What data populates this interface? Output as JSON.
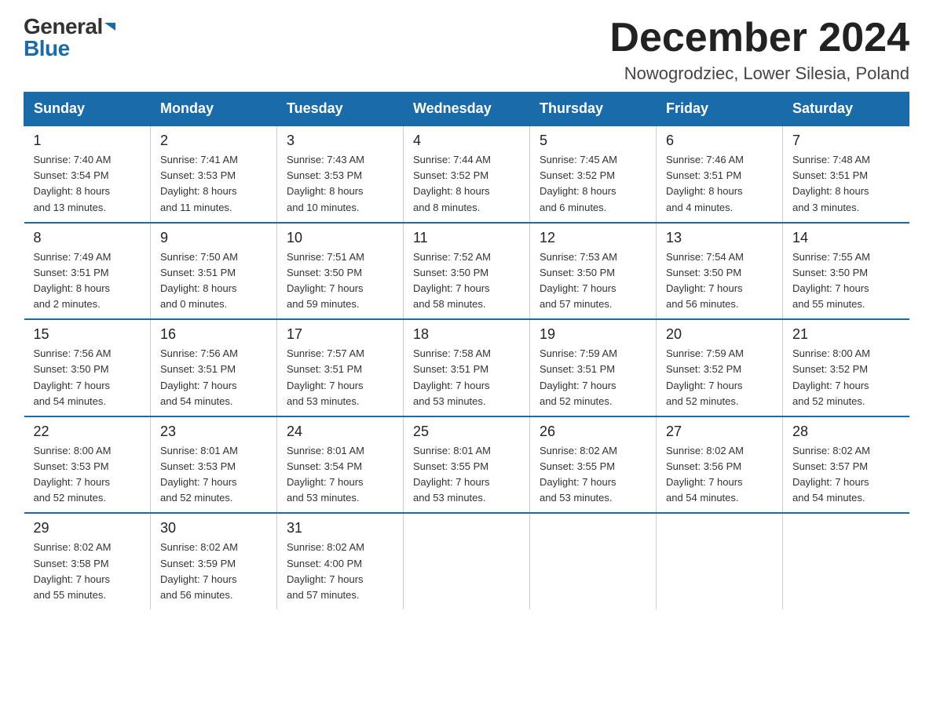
{
  "logo": {
    "general": "General",
    "blue": "Blue"
  },
  "title": "December 2024",
  "subtitle": "Nowogrodziec, Lower Silesia, Poland",
  "headers": [
    "Sunday",
    "Monday",
    "Tuesday",
    "Wednesday",
    "Thursday",
    "Friday",
    "Saturday"
  ],
  "weeks": [
    [
      {
        "day": "1",
        "info": "Sunrise: 7:40 AM\nSunset: 3:54 PM\nDaylight: 8 hours\nand 13 minutes."
      },
      {
        "day": "2",
        "info": "Sunrise: 7:41 AM\nSunset: 3:53 PM\nDaylight: 8 hours\nand 11 minutes."
      },
      {
        "day": "3",
        "info": "Sunrise: 7:43 AM\nSunset: 3:53 PM\nDaylight: 8 hours\nand 10 minutes."
      },
      {
        "day": "4",
        "info": "Sunrise: 7:44 AM\nSunset: 3:52 PM\nDaylight: 8 hours\nand 8 minutes."
      },
      {
        "day": "5",
        "info": "Sunrise: 7:45 AM\nSunset: 3:52 PM\nDaylight: 8 hours\nand 6 minutes."
      },
      {
        "day": "6",
        "info": "Sunrise: 7:46 AM\nSunset: 3:51 PM\nDaylight: 8 hours\nand 4 minutes."
      },
      {
        "day": "7",
        "info": "Sunrise: 7:48 AM\nSunset: 3:51 PM\nDaylight: 8 hours\nand 3 minutes."
      }
    ],
    [
      {
        "day": "8",
        "info": "Sunrise: 7:49 AM\nSunset: 3:51 PM\nDaylight: 8 hours\nand 2 minutes."
      },
      {
        "day": "9",
        "info": "Sunrise: 7:50 AM\nSunset: 3:51 PM\nDaylight: 8 hours\nand 0 minutes."
      },
      {
        "day": "10",
        "info": "Sunrise: 7:51 AM\nSunset: 3:50 PM\nDaylight: 7 hours\nand 59 minutes."
      },
      {
        "day": "11",
        "info": "Sunrise: 7:52 AM\nSunset: 3:50 PM\nDaylight: 7 hours\nand 58 minutes."
      },
      {
        "day": "12",
        "info": "Sunrise: 7:53 AM\nSunset: 3:50 PM\nDaylight: 7 hours\nand 57 minutes."
      },
      {
        "day": "13",
        "info": "Sunrise: 7:54 AM\nSunset: 3:50 PM\nDaylight: 7 hours\nand 56 minutes."
      },
      {
        "day": "14",
        "info": "Sunrise: 7:55 AM\nSunset: 3:50 PM\nDaylight: 7 hours\nand 55 minutes."
      }
    ],
    [
      {
        "day": "15",
        "info": "Sunrise: 7:56 AM\nSunset: 3:50 PM\nDaylight: 7 hours\nand 54 minutes."
      },
      {
        "day": "16",
        "info": "Sunrise: 7:56 AM\nSunset: 3:51 PM\nDaylight: 7 hours\nand 54 minutes."
      },
      {
        "day": "17",
        "info": "Sunrise: 7:57 AM\nSunset: 3:51 PM\nDaylight: 7 hours\nand 53 minutes."
      },
      {
        "day": "18",
        "info": "Sunrise: 7:58 AM\nSunset: 3:51 PM\nDaylight: 7 hours\nand 53 minutes."
      },
      {
        "day": "19",
        "info": "Sunrise: 7:59 AM\nSunset: 3:51 PM\nDaylight: 7 hours\nand 52 minutes."
      },
      {
        "day": "20",
        "info": "Sunrise: 7:59 AM\nSunset: 3:52 PM\nDaylight: 7 hours\nand 52 minutes."
      },
      {
        "day": "21",
        "info": "Sunrise: 8:00 AM\nSunset: 3:52 PM\nDaylight: 7 hours\nand 52 minutes."
      }
    ],
    [
      {
        "day": "22",
        "info": "Sunrise: 8:00 AM\nSunset: 3:53 PM\nDaylight: 7 hours\nand 52 minutes."
      },
      {
        "day": "23",
        "info": "Sunrise: 8:01 AM\nSunset: 3:53 PM\nDaylight: 7 hours\nand 52 minutes."
      },
      {
        "day": "24",
        "info": "Sunrise: 8:01 AM\nSunset: 3:54 PM\nDaylight: 7 hours\nand 53 minutes."
      },
      {
        "day": "25",
        "info": "Sunrise: 8:01 AM\nSunset: 3:55 PM\nDaylight: 7 hours\nand 53 minutes."
      },
      {
        "day": "26",
        "info": "Sunrise: 8:02 AM\nSunset: 3:55 PM\nDaylight: 7 hours\nand 53 minutes."
      },
      {
        "day": "27",
        "info": "Sunrise: 8:02 AM\nSunset: 3:56 PM\nDaylight: 7 hours\nand 54 minutes."
      },
      {
        "day": "28",
        "info": "Sunrise: 8:02 AM\nSunset: 3:57 PM\nDaylight: 7 hours\nand 54 minutes."
      }
    ],
    [
      {
        "day": "29",
        "info": "Sunrise: 8:02 AM\nSunset: 3:58 PM\nDaylight: 7 hours\nand 55 minutes."
      },
      {
        "day": "30",
        "info": "Sunrise: 8:02 AM\nSunset: 3:59 PM\nDaylight: 7 hours\nand 56 minutes."
      },
      {
        "day": "31",
        "info": "Sunrise: 8:02 AM\nSunset: 4:00 PM\nDaylight: 7 hours\nand 57 minutes."
      },
      null,
      null,
      null,
      null
    ]
  ]
}
